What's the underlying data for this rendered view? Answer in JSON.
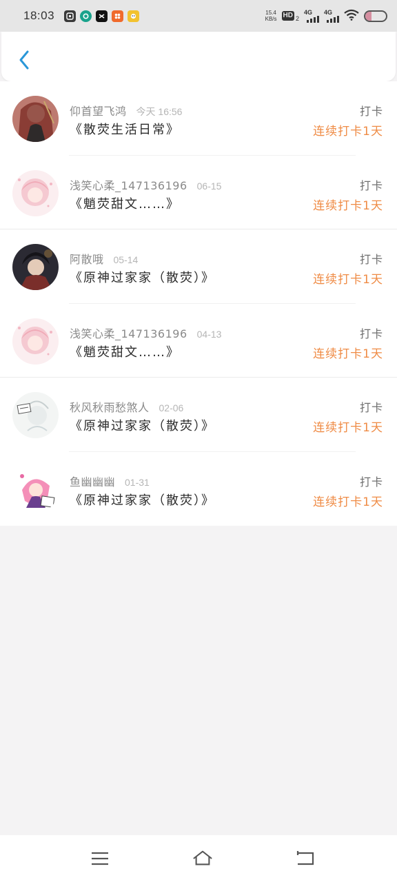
{
  "status_bar": {
    "time": "18:03",
    "net_speed_value": "15.4",
    "net_speed_unit": "KB/s",
    "hd_label": "HD",
    "hd_sub": "2",
    "sim1_label": "4G",
    "sim2_label": "4G",
    "apps": [
      {
        "icon": "app-icon-1",
        "color": "#3a3a3a"
      },
      {
        "icon": "app-icon-2",
        "color": "#1aa38c"
      },
      {
        "icon": "capcut-icon",
        "color": "#111111"
      },
      {
        "icon": "app-icon-4",
        "color": "#f06a2c"
      },
      {
        "icon": "app-icon-5",
        "color": "#f2c230"
      }
    ],
    "battery_level": 0.3
  },
  "header": {
    "back_icon": "chevron-left-icon",
    "accent": "#2a97d8"
  },
  "records": [
    {
      "username": "仰首望飞鸿",
      "date": "今天 16:56",
      "book": "《散荧生活日常》",
      "checkin": "打卡",
      "streak": "连续打卡1天"
    },
    {
      "username": "浅笑心柔_147136196",
      "date": "06-15",
      "book": "《魈荧甜文……》",
      "checkin": "打卡",
      "streak": "连续打卡1天"
    },
    {
      "username": "阿散哦",
      "date": "05-14",
      "book": "《原神过家家（散荧）》",
      "checkin": "打卡",
      "streak": "连续打卡1天"
    },
    {
      "username": "浅笑心柔_147136196",
      "date": "04-13",
      "book": "《魈荧甜文……》",
      "checkin": "打卡",
      "streak": "连续打卡1天"
    },
    {
      "username": "秋风秋雨愁煞人",
      "date": "02-06",
      "book": "《原神过家家（散荧）》",
      "checkin": "打卡",
      "streak": "连续打卡1天"
    },
    {
      "username": "鱼幽幽幽",
      "date": "01-31",
      "book": "《原神过家家（散荧）》",
      "checkin": "打卡",
      "streak": "连续打卡1天"
    }
  ],
  "colors": {
    "streak": "#ef8b45",
    "background": "#f4f3f4"
  },
  "nav": {
    "menu_icon": "menu-icon",
    "home_icon": "home-icon",
    "back_icon": "back-icon"
  }
}
